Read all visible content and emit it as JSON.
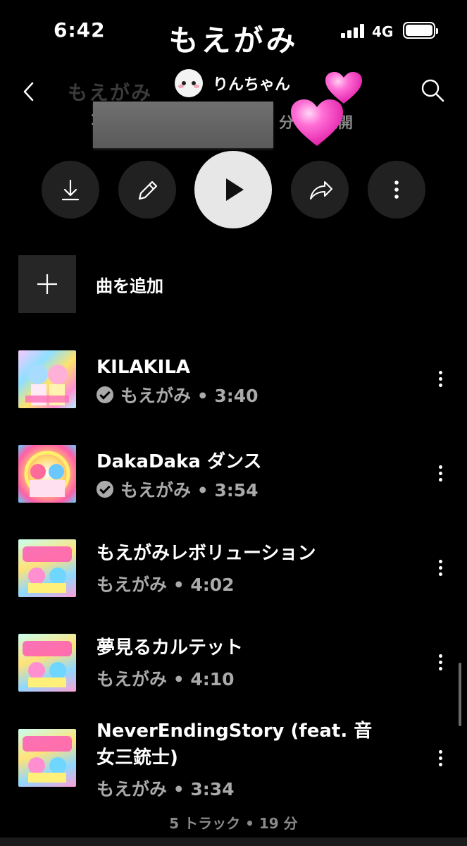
{
  "status_bar": {
    "time": "6:42",
    "network": "4G"
  },
  "overlay_title": "もえがみ",
  "header": {
    "faded_title": "もえがみ",
    "owner_name": "りんちゃん",
    "meta_visible_suffix": "分・非公開",
    "meta_prefix_char": "1"
  },
  "actions": {
    "download_icon": "download-icon",
    "edit_icon": "pencil-icon",
    "play_icon": "play-icon",
    "share_icon": "share-icon",
    "more_icon": "more-vertical-icon"
  },
  "add_song_label": "曲を追加",
  "tracks": [
    {
      "title": "KILAKILA",
      "artist": "もえがみ",
      "duration": "3:40",
      "verified": true,
      "subtitle": "もえがみ • 3:40"
    },
    {
      "title": "DakaDaka ダンス",
      "artist": "もえがみ",
      "duration": "3:54",
      "verified": true,
      "subtitle": "もえがみ • 3:54"
    },
    {
      "title": "もえがみレボリューション",
      "artist": "もえがみ",
      "duration": "4:02",
      "verified": false,
      "subtitle": "もえがみ • 4:02"
    },
    {
      "title": "夢見るカルテット",
      "artist": "もえがみ",
      "duration": "4:10",
      "verified": false,
      "subtitle": "もえがみ • 4:10"
    },
    {
      "title_line1": "NeverEndingStory (feat. 音",
      "title_line2": "女三銃士)",
      "artist": "もえがみ",
      "duration": "3:34",
      "verified": false,
      "subtitle": "もえがみ • 3:34"
    }
  ],
  "footer": "5 トラック • 19 分",
  "colors": {
    "background": "#000000",
    "secondary_text": "#aaaaaa",
    "button_bg": "#212121",
    "heart": "#ff4fc8"
  }
}
